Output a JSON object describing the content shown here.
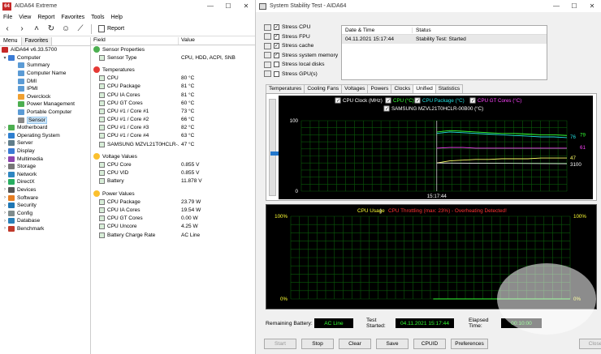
{
  "left_window": {
    "title": "AIDA64 Extreme",
    "app_icon_text": "64",
    "menu": [
      "File",
      "View",
      "Report",
      "Favorites",
      "Tools",
      "Help"
    ],
    "toolbar_report": "Report",
    "tree_tabs": [
      "Menu",
      "Favorites"
    ],
    "tree": [
      {
        "label": "AIDA64 v6.33.5700",
        "level": 0,
        "arrow": "",
        "color": "#c62828"
      },
      {
        "label": "Computer",
        "level": 1,
        "arrow": "▾",
        "color": "#3a7bd5"
      },
      {
        "label": "Summary",
        "level": 2,
        "arrow": "",
        "color": "#5b9bd5"
      },
      {
        "label": "Computer Name",
        "level": 2,
        "arrow": "",
        "color": "#5b9bd5"
      },
      {
        "label": "DMI",
        "level": 2,
        "arrow": "",
        "color": "#5b9bd5"
      },
      {
        "label": "IPMI",
        "level": 2,
        "arrow": "",
        "color": "#5b9bd5"
      },
      {
        "label": "Overclock",
        "level": 2,
        "arrow": "",
        "color": "#f0a030"
      },
      {
        "label": "Power Management",
        "level": 2,
        "arrow": "",
        "color": "#4caf50"
      },
      {
        "label": "Portable Computer",
        "level": 2,
        "arrow": "",
        "color": "#5b9bd5"
      },
      {
        "label": "Sensor",
        "level": 2,
        "arrow": "",
        "color": "#888888",
        "selected": true
      },
      {
        "label": "Motherboard",
        "level": 1,
        "arrow": "›",
        "color": "#4caf50"
      },
      {
        "label": "Operating System",
        "level": 1,
        "arrow": "›",
        "color": "#2e7fd0"
      },
      {
        "label": "Server",
        "level": 1,
        "arrow": "›",
        "color": "#607d8b"
      },
      {
        "label": "Display",
        "level": 1,
        "arrow": "›",
        "color": "#3a7bd5"
      },
      {
        "label": "Multimedia",
        "level": 1,
        "arrow": "›",
        "color": "#8e44ad"
      },
      {
        "label": "Storage",
        "level": 1,
        "arrow": "›",
        "color": "#777777"
      },
      {
        "label": "Network",
        "level": 1,
        "arrow": "›",
        "color": "#2e86c1"
      },
      {
        "label": "DirectX",
        "level": 1,
        "arrow": "›",
        "color": "#27ae60"
      },
      {
        "label": "Devices",
        "level": 1,
        "arrow": "›",
        "color": "#555555"
      },
      {
        "label": "Software",
        "level": 1,
        "arrow": "›",
        "color": "#e67e22"
      },
      {
        "label": "Security",
        "level": 1,
        "arrow": "›",
        "color": "#1f77b4"
      },
      {
        "label": "Config",
        "level": 1,
        "arrow": "›",
        "color": "#7f8c8d"
      },
      {
        "label": "Database",
        "level": 1,
        "arrow": "›",
        "color": "#2980b9"
      },
      {
        "label": "Benchmark",
        "level": 1,
        "arrow": "›",
        "color": "#c0392b"
      }
    ],
    "columns": [
      "Field",
      "Value"
    ],
    "details": [
      {
        "type": "group",
        "field": "Sensor Properties",
        "value": ""
      },
      {
        "type": "item",
        "field": "Sensor Type",
        "value": "CPU, HDD, ACPI, SNB"
      },
      {
        "type": "gap"
      },
      {
        "type": "group",
        "field": "Temperatures",
        "value": ""
      },
      {
        "type": "item",
        "field": "CPU",
        "value": "80 °C"
      },
      {
        "type": "item",
        "field": "CPU Package",
        "value": "81 °C"
      },
      {
        "type": "item",
        "field": "CPU IA Cores",
        "value": "81 °C"
      },
      {
        "type": "item",
        "field": "CPU GT Cores",
        "value": "60 °C"
      },
      {
        "type": "item",
        "field": "CPU #1 / Core #1",
        "value": "73 °C"
      },
      {
        "type": "item",
        "field": "CPU #1 / Core #2",
        "value": "66 °C"
      },
      {
        "type": "item",
        "field": "CPU #1 / Core #3",
        "value": "82 °C"
      },
      {
        "type": "item",
        "field": "CPU #1 / Core #4",
        "value": "63 °C"
      },
      {
        "type": "item",
        "field": "SAMSUNG MZVL21T0HCLR-...",
        "value": "47 °C"
      },
      {
        "type": "gap"
      },
      {
        "type": "group",
        "field": "Voltage Values",
        "value": ""
      },
      {
        "type": "item",
        "field": "CPU Core",
        "value": "0.855 V"
      },
      {
        "type": "item",
        "field": "CPU VID",
        "value": "0.855 V"
      },
      {
        "type": "item",
        "field": "Battery",
        "value": "11.878 V"
      },
      {
        "type": "gap"
      },
      {
        "type": "group",
        "field": "Power Values",
        "value": ""
      },
      {
        "type": "item",
        "field": "CPU Package",
        "value": "23.79 W"
      },
      {
        "type": "item",
        "field": "CPU IA Cores",
        "value": "19.54 W"
      },
      {
        "type": "item",
        "field": "CPU GT Cores",
        "value": "0.00 W"
      },
      {
        "type": "item",
        "field": "CPU Uncore",
        "value": "4.25 W"
      },
      {
        "type": "item",
        "field": "Battery Charge Rate",
        "value": "AC Line"
      }
    ]
  },
  "right_window": {
    "title": "System Stability Test - AIDA64",
    "stress": [
      {
        "label": "Stress CPU",
        "checked": true
      },
      {
        "label": "Stress FPU",
        "checked": true
      },
      {
        "label": "Stress cache",
        "checked": true
      },
      {
        "label": "Stress system memory",
        "checked": true
      },
      {
        "label": "Stress local disks",
        "checked": false
      },
      {
        "label": "Stress GPU(s)",
        "checked": false
      }
    ],
    "log_columns": [
      "Date & Time",
      "Status"
    ],
    "log_rows": [
      {
        "time": "04.11.2021 15:17:44",
        "status": "Stability Test: Started"
      }
    ],
    "tabs": [
      "Temperatures",
      "Cooling Fans",
      "Voltages",
      "Powers",
      "Clocks",
      "Unified",
      "Statistics"
    ],
    "active_tab": "Unified",
    "unified_legend": [
      {
        "label": "CPU Clock (MHz)",
        "color": "#ffffff"
      },
      {
        "label": "CPU (°C)",
        "color": "#33ff33"
      },
      {
        "label": "CPU Package (°C)",
        "color": "#22e0e0"
      },
      {
        "label": "CPU GT Cores (°C)",
        "color": "#ff44ff"
      },
      {
        "label": "SAMSUNG MZVL21T0HCLR-00B00 (°C)",
        "color": "#ffffff"
      }
    ],
    "unified_axis": {
      "top": "100",
      "bottom": "0",
      "time": "15:17:44"
    },
    "unified_values": [
      {
        "text": "76",
        "color": "#22e0e0"
      },
      {
        "text": "79",
        "color": "#33ff33"
      },
      {
        "text": "61",
        "color": "#ff44ff"
      },
      {
        "text": "47",
        "color": "#ffff66"
      },
      {
        "text": "3100",
        "color": "#ffffff"
      }
    ],
    "usage_title": {
      "a": "CPU Usage",
      "sep": " | ",
      "b": "CPU Throttling (max: 23%) - Overheating Detected!"
    },
    "usage_axis": {
      "left_top": "100%",
      "left_bottom": "0%",
      "right_top": "100%",
      "right_bottom": "0%"
    },
    "status": {
      "battery_label": "Remaining Battery:",
      "battery_value": "AC Line",
      "started_label": "Test Started:",
      "started_value": "04.11.2021 15:17:44",
      "elapsed_label": "Elapsed Time:",
      "elapsed_value": "00:10:00"
    },
    "buttons": [
      {
        "label": "Start",
        "enabled": false
      },
      {
        "label": "Stop",
        "enabled": true
      },
      {
        "label": "Clear",
        "enabled": true
      },
      {
        "label": "Save",
        "enabled": true
      },
      {
        "label": "CPUID",
        "enabled": true
      },
      {
        "label": "Preferences",
        "enabled": true
      },
      {
        "label": "Close",
        "enabled": false
      }
    ]
  },
  "chart_data": [
    {
      "type": "line",
      "title": "",
      "x": [
        0,
        4,
        8,
        12,
        16,
        20,
        24,
        28,
        32,
        36,
        40
      ],
      "ylim": [
        0,
        100
      ],
      "series": [
        {
          "name": "CPU (°C)",
          "values": [
            84,
            86,
            85,
            84,
            83,
            82,
            82,
            81,
            80,
            80,
            79
          ]
        },
        {
          "name": "CPU Package (°C)",
          "values": [
            82,
            84,
            83,
            82,
            81,
            80,
            79,
            78,
            77,
            77,
            76
          ]
        },
        {
          "name": "CPU GT Cores (°C)",
          "values": [
            61,
            62,
            62,
            61,
            61,
            61,
            61,
            61,
            61,
            61,
            61
          ]
        },
        {
          "name": "SAMSUNG MZVL21T0HCLR-00B00 (°C)",
          "values": [
            40,
            43,
            44,
            45,
            45,
            46,
            46,
            46,
            47,
            47,
            47
          ]
        }
      ]
    },
    {
      "type": "area",
      "title": "CPU Usage",
      "x": [
        0,
        4,
        8,
        12,
        16,
        20,
        24,
        28,
        32,
        36,
        40
      ],
      "ylim": [
        0,
        100
      ],
      "series": [
        {
          "name": "CPU Usage",
          "values": [
            0,
            0,
            0,
            0,
            0,
            0,
            0,
            0,
            0,
            0,
            0
          ]
        }
      ]
    }
  ]
}
